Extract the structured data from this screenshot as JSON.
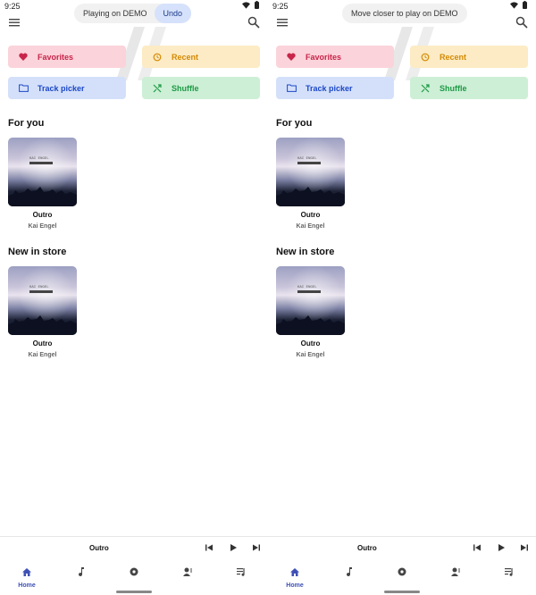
{
  "screens": [
    {
      "status_time": "9:25",
      "toast": {
        "text": "Playing on DEMO",
        "action": "Undo"
      },
      "chips": {
        "favorites": "Favorites",
        "recent": "Recent",
        "track_picker": "Track picker",
        "shuffle": "Shuffle"
      },
      "sections": {
        "for_you": "For you",
        "new_in_store": "New in store"
      },
      "album_for_you": {
        "title": "Outro",
        "artist": "Kai Engel"
      },
      "album_new": {
        "title": "Outro",
        "artist": "Kai Engel"
      },
      "now_playing": "Outro",
      "nav_home_label": "Home"
    },
    {
      "status_time": "9:25",
      "toast": {
        "text": "Move closer to play on DEMO"
      },
      "chips": {
        "favorites": "Favorites",
        "recent": "Recent",
        "track_picker": "Track picker",
        "shuffle": "Shuffle"
      },
      "sections": {
        "for_you": "For you",
        "new_in_store": "New in store"
      },
      "album_for_you": {
        "title": "Outro",
        "artist": "Kai Engel"
      },
      "album_new": {
        "title": "Outro",
        "artist": "Kai Engel"
      },
      "now_playing": "Outro",
      "nav_home_label": "Home"
    }
  ],
  "colors": {
    "favorites_bg": "#fbd3da",
    "favorites_fg": "#c8254a",
    "recent_bg": "#fcebc4",
    "recent_fg": "#d48a05",
    "track_bg": "#d4e0fa",
    "track_fg": "#1b47c6",
    "shuffle_bg": "#cdefd6",
    "shuffle_fg": "#1d9a44",
    "accent": "#3f51b5"
  },
  "icons": [
    "menu-icon",
    "search-icon",
    "heart-icon",
    "history-icon",
    "folder-icon",
    "shuffle-icon",
    "home-icon",
    "music-note-icon",
    "album-icon",
    "artist-icon",
    "playlist-icon",
    "skip-previous-icon",
    "play-icon",
    "skip-next-icon",
    "wifi-icon",
    "battery-icon"
  ]
}
